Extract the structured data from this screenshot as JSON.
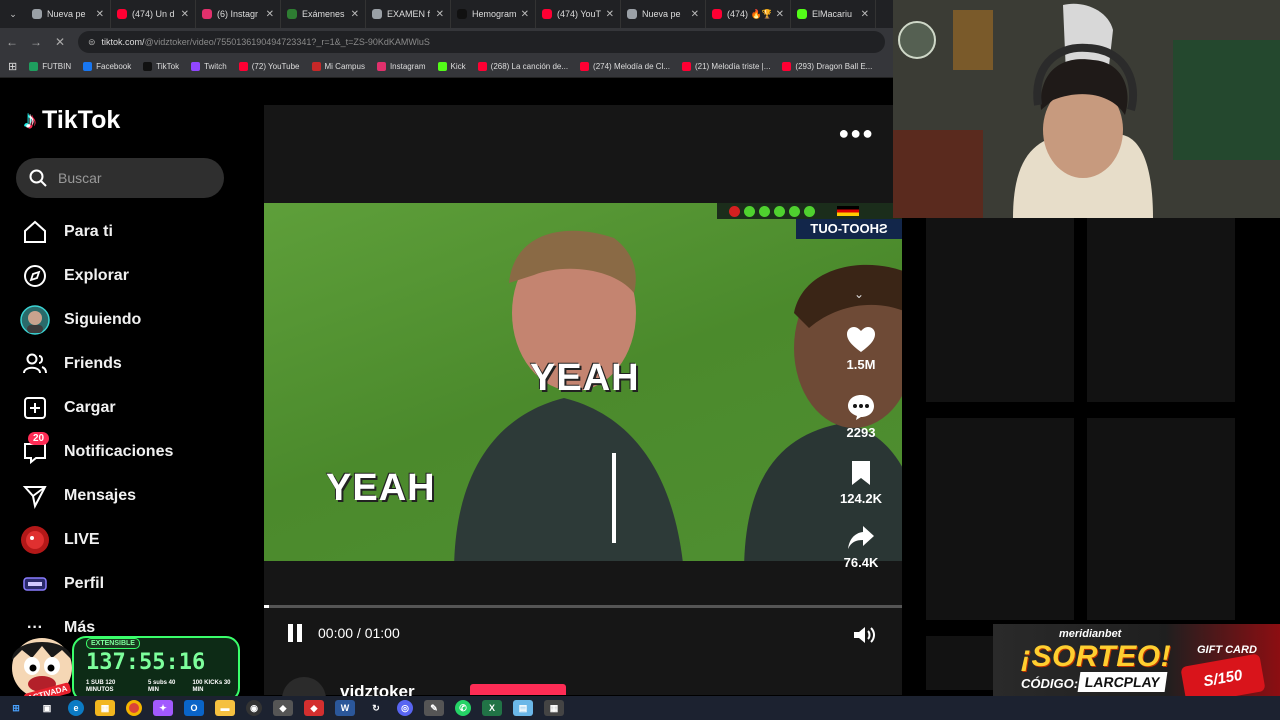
{
  "browser": {
    "tabs": [
      {
        "label": "Nueva pe",
        "color": "#9aa0a6"
      },
      {
        "label": "(474) Un d",
        "color": "#ff0033"
      },
      {
        "label": "(6) Instagr",
        "color": "#e1306c"
      },
      {
        "label": "Exámenes",
        "color": "#2e7d32"
      },
      {
        "label": "EXAMEN f",
        "color": "#9aa0a6"
      },
      {
        "label": "Hemogram",
        "color": "#111111"
      },
      {
        "label": "(474) YouT",
        "color": "#ff0033"
      },
      {
        "label": "Nueva pe",
        "color": "#9aa0a6"
      },
      {
        "label": "(474) 🔥🏆",
        "color": "#ff0033"
      },
      {
        "label": "ElMacariu",
        "color": "#53fc18"
      }
    ],
    "url": "tiktok.com/",
    "url_rest": "@vidztoker/video/7550136190494723341?_r=1&_t=ZS-90KdKAMWluS",
    "bookmarks": [
      {
        "label": "FUTBIN",
        "color": "#1e9e5e"
      },
      {
        "label": "Facebook",
        "color": "#1877f2"
      },
      {
        "label": "TikTok",
        "color": "#111111"
      },
      {
        "label": "Twitch",
        "color": "#9146ff"
      },
      {
        "label": "(72) YouTube",
        "color": "#ff0033"
      },
      {
        "label": "Mi Campus",
        "color": "#c62828"
      },
      {
        "label": "Instagram",
        "color": "#e1306c"
      },
      {
        "label": "Kick",
        "color": "#53fc18"
      },
      {
        "label": "(268) La canción de...",
        "color": "#ff0033"
      },
      {
        "label": "(274) Melodía de Cl...",
        "color": "#ff0033"
      },
      {
        "label": "(21) Melodía triste |...",
        "color": "#ff0033"
      },
      {
        "label": "(293) Dragon Ball E...",
        "color": "#ff0033"
      }
    ]
  },
  "sidebar": {
    "logo_text": "TikTok",
    "search_placeholder": "Buscar",
    "items": [
      {
        "label": "Para ti"
      },
      {
        "label": "Explorar"
      },
      {
        "label": "Siguiendo"
      },
      {
        "label": "Friends"
      },
      {
        "label": "Cargar"
      },
      {
        "label": "Notificaciones",
        "badge": "20"
      },
      {
        "label": "Mensajes"
      },
      {
        "label": "LIVE"
      },
      {
        "label": "Perfil"
      },
      {
        "label": "Más"
      }
    ]
  },
  "video": {
    "caption_top": "YEAH",
    "caption_bottom": "YEAH",
    "shootout_label": "SHOOT-OUT",
    "likes": "1.5M",
    "comments": "2293",
    "saves": "124.2K",
    "shares": "76.4K",
    "time_current": "00:00",
    "time_total": "01:00",
    "author": "vidztoker",
    "progress_fraction": 0.008,
    "accent_color": "#fe2c55"
  },
  "stream_overlay": {
    "extensible_tag": "EXTENSIBLE",
    "timer": "137:55:16",
    "legend": [
      "1 SUB 120 MINUTOS",
      "5 subs 40 MIN",
      "100 KICKs 30 MIN"
    ],
    "mascot_label": "ACTIVADA",
    "promo_brand": "meridianbet",
    "promo_title": "¡SORTEO!",
    "promo_code_label": "CÓDIGO:",
    "promo_code": "LARCPLAY",
    "promo_gift": "GIFT CARD",
    "promo_amount": "S/150"
  }
}
